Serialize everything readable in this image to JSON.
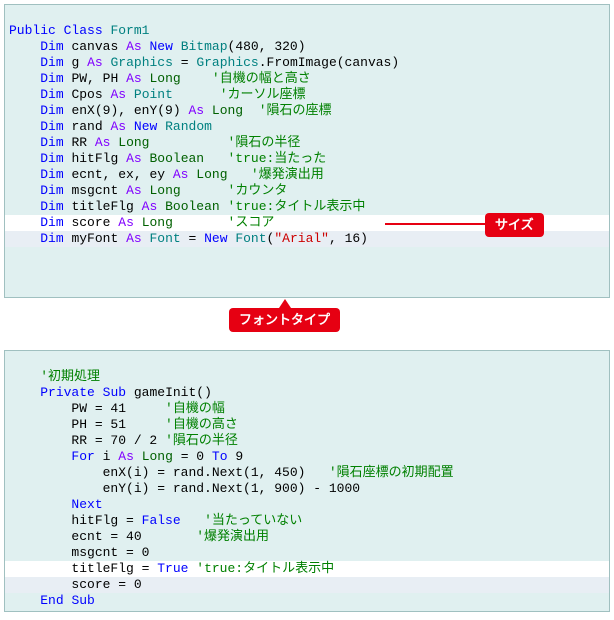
{
  "block1": {
    "l1": {
      "a": "Public",
      "b": "Class",
      "c": "Form1"
    },
    "l2": {
      "a": "Dim",
      "b": "canvas",
      "c": "As",
      "d": "New",
      "e": "Bitmap",
      "f": "(480, 320)"
    },
    "l3": {
      "a": "Dim",
      "b": "g",
      "c": "As",
      "d": "Graphics",
      "e": " = ",
      "f": "Graphics",
      "g": ".FromImage(canvas)"
    },
    "l4": {
      "a": "Dim",
      "b": "PW, PH",
      "c": "As",
      "d": "Long",
      "e": "'自機の幅と高さ"
    },
    "l5": {
      "a": "Dim",
      "b": "Cpos",
      "c": "As",
      "d": "Point",
      "e": "'カーソル座標"
    },
    "l6": {
      "a": "Dim",
      "b": "enX(9), enY(9)",
      "c": "As",
      "d": "Long",
      "e": "'隕石の座標"
    },
    "l7": {
      "a": "Dim",
      "b": "rand",
      "c": "As",
      "d": "New",
      "e": "Random"
    },
    "l8": {
      "a": "Dim",
      "b": "RR",
      "c": "As",
      "d": "Long",
      "e": "'隕石の半径"
    },
    "l9": {
      "a": "Dim",
      "b": "hitFlg",
      "c": "As",
      "d": "Boolean",
      "e": "'true:当たった"
    },
    "l10": {
      "a": "Dim",
      "b": "ecnt, ex, ey",
      "c": "As",
      "d": "Long",
      "e": "'爆発演出用"
    },
    "l11": {
      "a": "Dim",
      "b": "msgcnt",
      "c": "As",
      "d": "Long",
      "e": "'カウンタ"
    },
    "l12": {
      "a": "Dim",
      "b": "titleFlg",
      "c": "As",
      "d": "Boolean",
      "e": "'true:タイトル表示中"
    },
    "l13": {
      "a": "Dim",
      "b": "score",
      "c": "As",
      "d": "Long",
      "e": "'スコア"
    },
    "l14": {
      "a": "Dim",
      "b": "myFont",
      "c": "As",
      "d": "Font",
      "e": " = ",
      "f": "New",
      "g": "Font",
      "h": "(",
      "i": "\"Arial\"",
      "j": ", 16)"
    }
  },
  "callouts": {
    "fontType": "フォントタイプ",
    "size": "サイズ"
  },
  "block2": {
    "l1": {
      "a": "'初期処理"
    },
    "l2": {
      "a": "Private",
      "b": "Sub",
      "c": "gameInit()"
    },
    "l3": {
      "a": "PW = 41",
      "b": "'自機の幅"
    },
    "l4": {
      "a": "PH = 51",
      "b": "'自機の高さ"
    },
    "l5": {
      "a": "RR = 70 / 2",
      "b": "'隕石の半径"
    },
    "l6": {
      "a": "For",
      "b": "i",
      "c": "As",
      "d": "Long",
      "e": " = 0 ",
      "f": "To",
      "g": " 9"
    },
    "l7": {
      "a": "enX(i) = rand.Next(1, 450)",
      "b": "'隕石座標の初期配置"
    },
    "l8": {
      "a": "enY(i) = rand.Next(1, 900) - 1000"
    },
    "l9": {
      "a": "Next"
    },
    "l10": {
      "a": "hitFlg = ",
      "b": "False",
      "c": "'当たっていない"
    },
    "l11": {
      "a": "ecnt = 40",
      "b": "'爆発演出用"
    },
    "l12": {
      "a": "msgcnt = 0"
    },
    "l13": {
      "a": "titleFlg = ",
      "b": "True",
      "c": "'true:タイトル表示中"
    },
    "l14": {
      "a": "score = 0"
    },
    "l15": {
      "a": "End",
      "b": "Sub"
    }
  }
}
